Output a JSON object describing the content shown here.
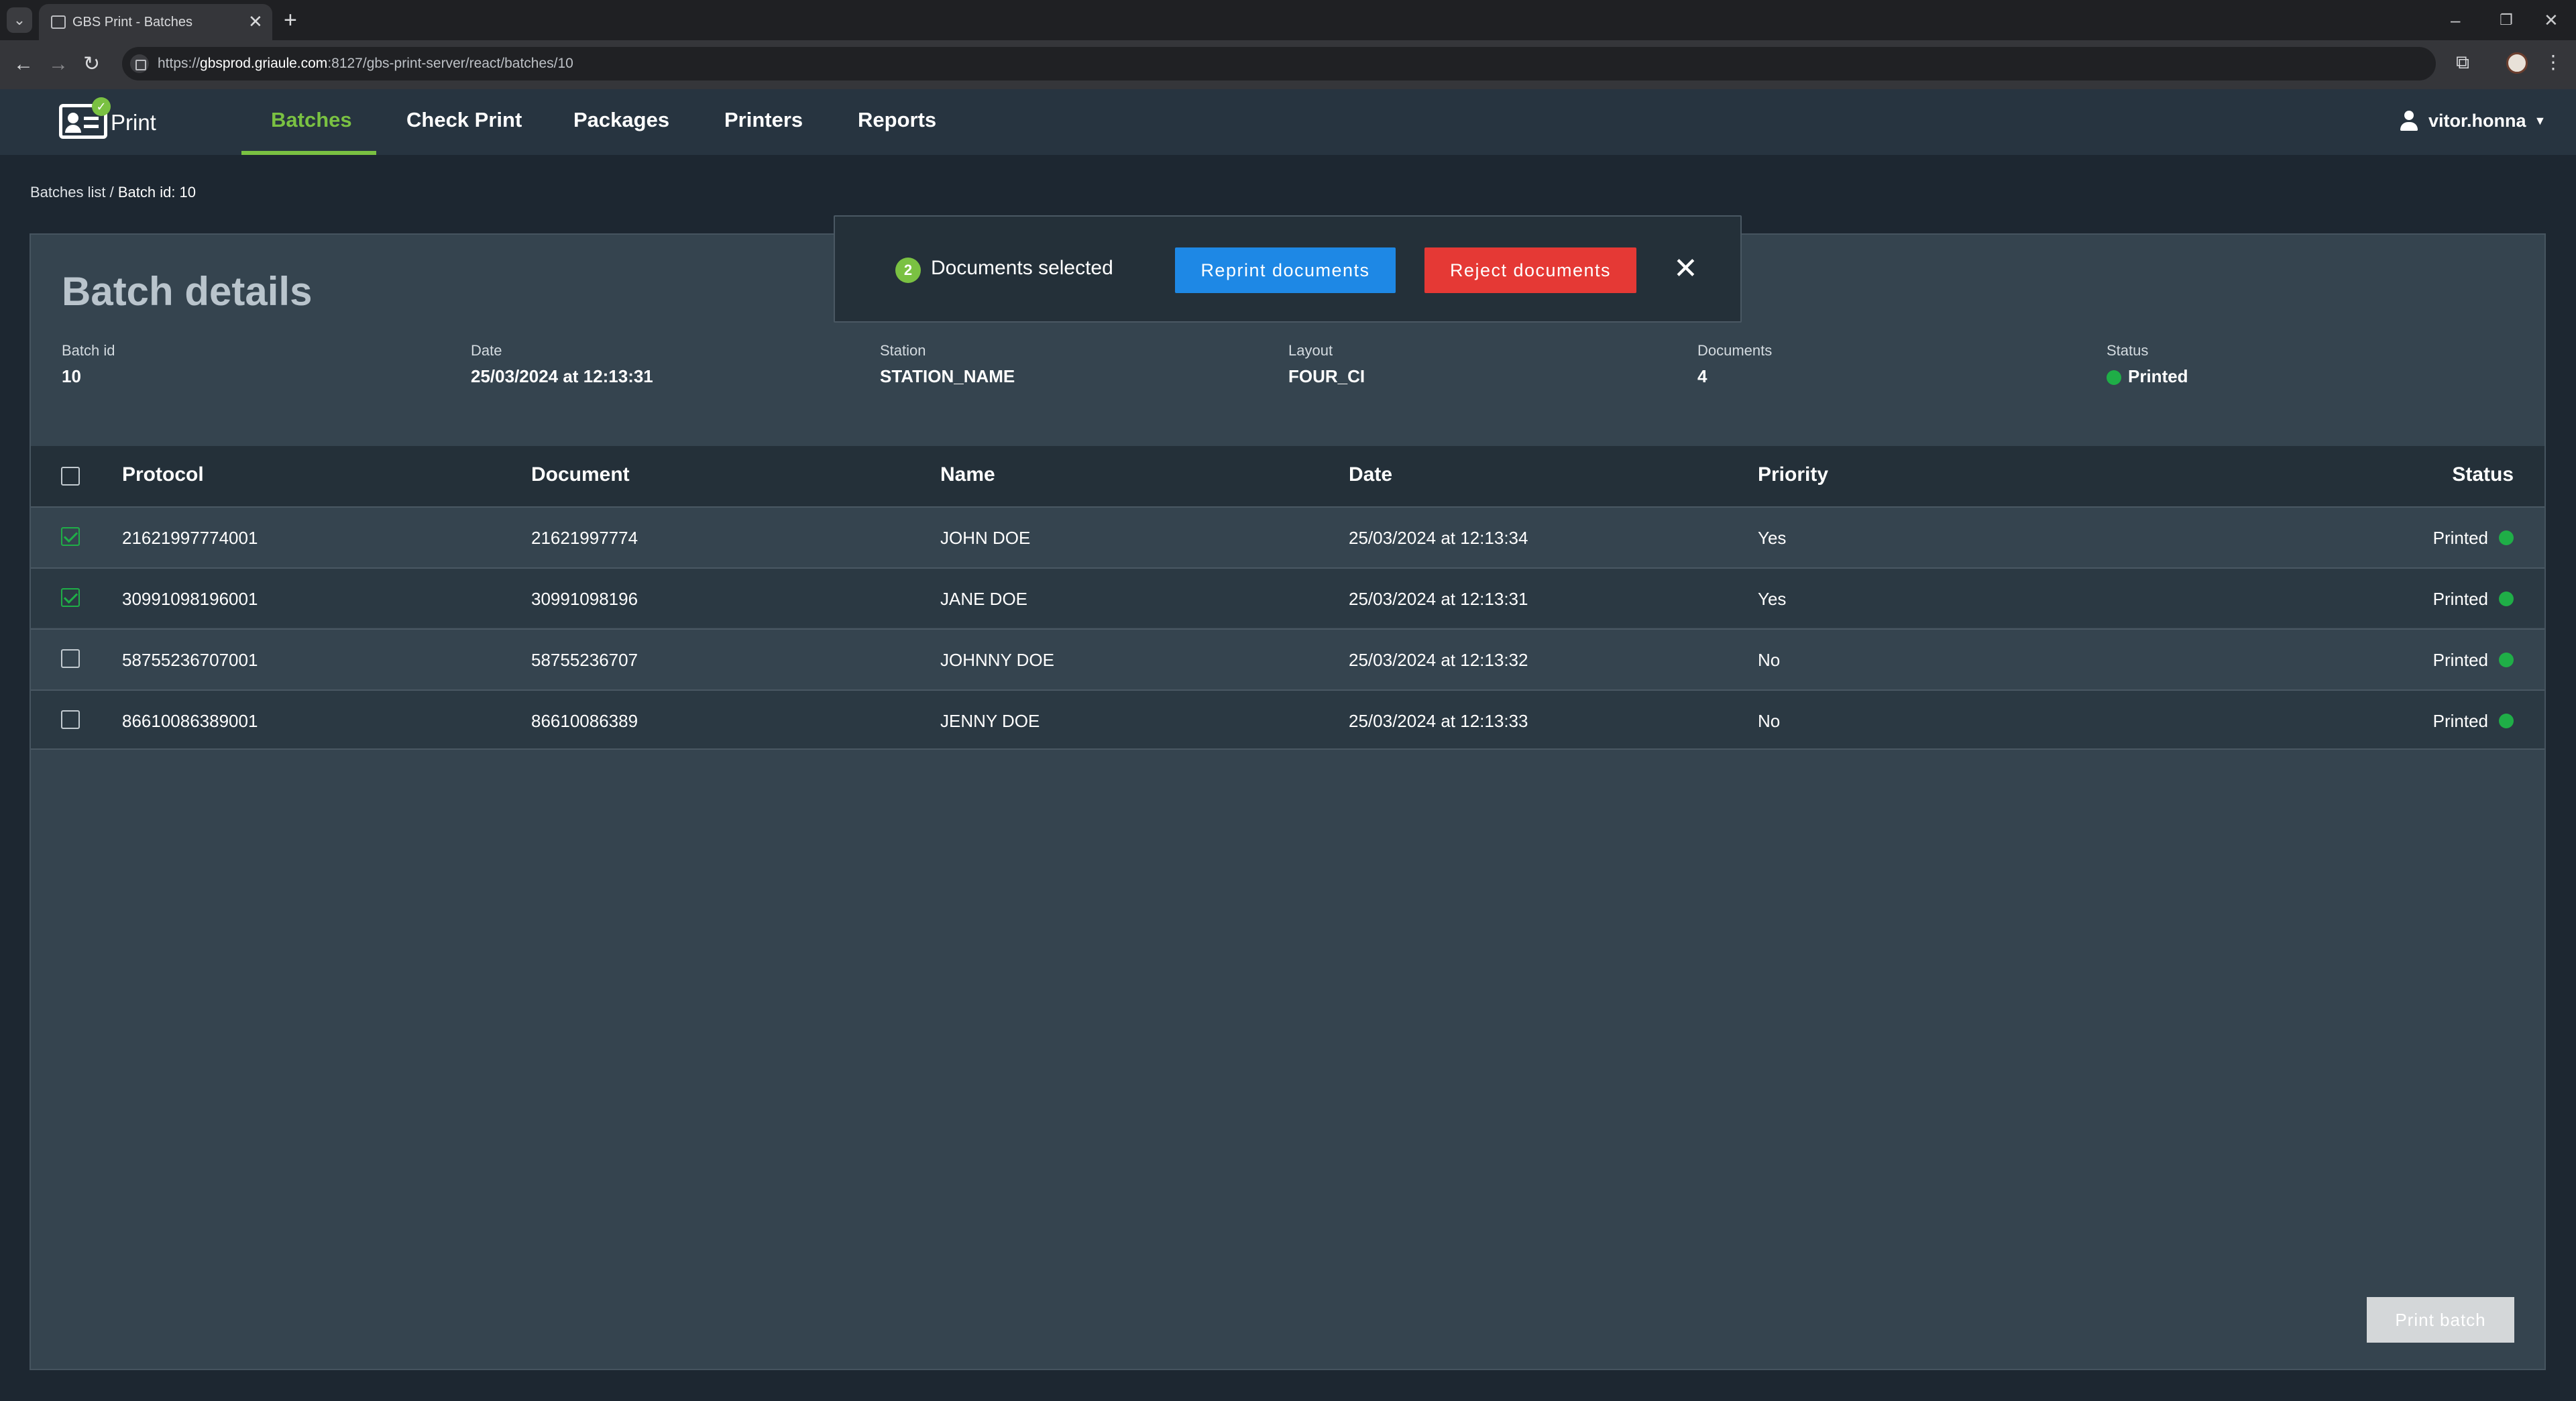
{
  "browser": {
    "tab_title": "GBS Print - Batches",
    "url_prefix": "https://",
    "url_host": "gbsprod.griaule.com",
    "url_path": ":8127/gbs-print-server/react/batches/10"
  },
  "header": {
    "logo_text": "Print",
    "nav": [
      "Batches",
      "Check Print",
      "Packages",
      "Printers",
      "Reports"
    ],
    "active_nav": "Batches",
    "user": "vitor.honna"
  },
  "breadcrumb": {
    "parent": "Batches list",
    "separator": " / ",
    "current": "Batch id: 10"
  },
  "batch": {
    "title": "Batch details",
    "fields": [
      {
        "label": "Batch id",
        "value": "10"
      },
      {
        "label": "Date",
        "value": "25/03/2024 at 12:13:31"
      },
      {
        "label": "Station",
        "value": "STATION_NAME"
      },
      {
        "label": "Layout",
        "value": "FOUR_CI"
      },
      {
        "label": "Documents",
        "value": "4"
      },
      {
        "label": "Status",
        "value": "Printed"
      }
    ]
  },
  "table": {
    "columns": [
      "Protocol",
      "Document",
      "Name",
      "Date",
      "Priority",
      "Status"
    ],
    "rows": [
      {
        "protocol": "21621997774001",
        "document": "21621997774",
        "name": "JOHN DOE",
        "date": "25/03/2024 at 12:13:34",
        "priority": "Yes",
        "status": "Printed",
        "checked": true
      },
      {
        "protocol": "30991098196001",
        "document": "30991098196",
        "name": "JANE DOE",
        "date": "25/03/2024 at 12:13:31",
        "priority": "Yes",
        "status": "Printed",
        "checked": true
      },
      {
        "protocol": "58755236707001",
        "document": "58755236707",
        "name": "JOHNNY DOE",
        "date": "25/03/2024 at 12:13:32",
        "priority": "No",
        "status": "Printed",
        "checked": false
      },
      {
        "protocol": "86610086389001",
        "document": "86610086389",
        "name": "JENNY DOE",
        "date": "25/03/2024 at 12:13:33",
        "priority": "No",
        "status": "Printed",
        "checked": false
      }
    ]
  },
  "selection_popup": {
    "count": "2",
    "text": "Documents selected",
    "reprint_label": "Reprint documents",
    "reject_label": "Reject documents"
  },
  "print_batch_label": "Print batch",
  "colors": {
    "accent_green": "#7ac142",
    "status_green": "#1fae47",
    "reprint_blue": "#1e88e5",
    "reject_red": "#e53935"
  }
}
